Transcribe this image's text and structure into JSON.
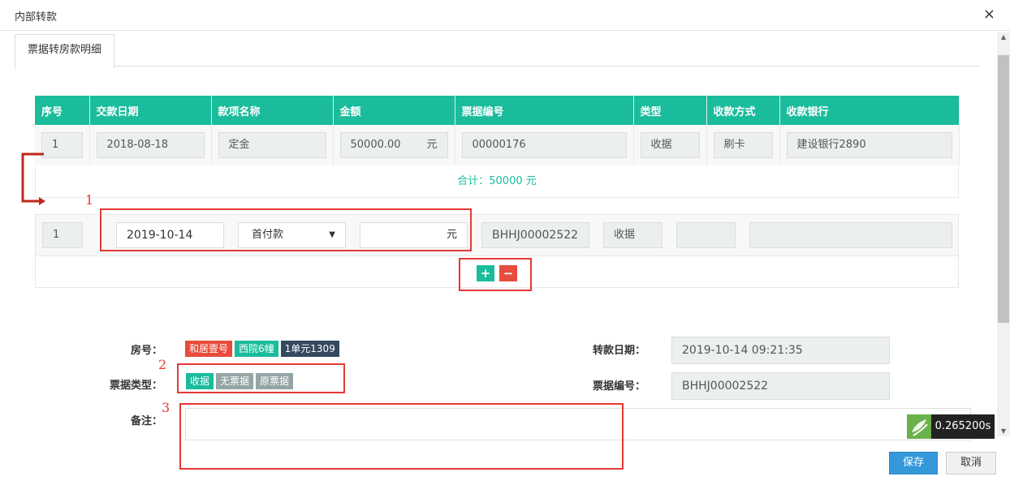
{
  "dialog": {
    "title": "内部转款",
    "close_icon": "×"
  },
  "tabs": [
    {
      "label": "票据转房款明细",
      "active": true
    }
  ],
  "grid": {
    "columns": [
      "序号",
      "交款日期",
      "款项名称",
      "金额",
      "票据编号",
      "类型",
      "收款方式",
      "收款银行"
    ],
    "rows": [
      {
        "seq": "1",
        "date": "2018-08-18",
        "item": "定金",
        "amount": "50000.00",
        "unit": "元",
        "receipt_no": "00000176",
        "type": "收据",
        "method": "刷卡",
        "bank": "建设银行2890"
      }
    ],
    "total": "合计：50000 元"
  },
  "new_row": {
    "seq": "1",
    "date": "2019-10-14",
    "item_selected": "首付款",
    "amount": "",
    "unit": "元",
    "receipt_no": "BHHJ00002522",
    "type": "收据",
    "method": "",
    "bank": ""
  },
  "row_actions": {
    "add": "+",
    "remove": "−"
  },
  "annotations": {
    "one": "1",
    "two": "2",
    "three": "3"
  },
  "form": {
    "room_label": "房号：",
    "room_tags": [
      {
        "text": "和居壹号",
        "color": "#e74c3c"
      },
      {
        "text": "西院6幢",
        "color": "#1abc9c"
      },
      {
        "text": "1单元1309",
        "color": "#34495e"
      }
    ],
    "receipt_type_label": "票据类型：",
    "receipt_types": [
      {
        "text": "收据",
        "color": "#1abc9c",
        "selected": true
      },
      {
        "text": "无票据",
        "color": "#95a5a6",
        "selected": false
      },
      {
        "text": "原票据",
        "color": "#95a5a6",
        "selected": false
      }
    ],
    "remark_label": "备注：",
    "remark_value": "",
    "transfer_date_label": "转款日期：",
    "transfer_date_value": "2019-10-14 09:21:35",
    "receipt_no_label": "票据编号：",
    "receipt_no_value": "BHHJ00002522"
  },
  "timer": {
    "value": "0.265200s"
  },
  "footer": {
    "save": "保存",
    "cancel": "取消"
  },
  "colors": {
    "accent": "#1abc9c",
    "danger": "#e74c3c",
    "primary": "#3498db",
    "annotation": "#e53935"
  }
}
